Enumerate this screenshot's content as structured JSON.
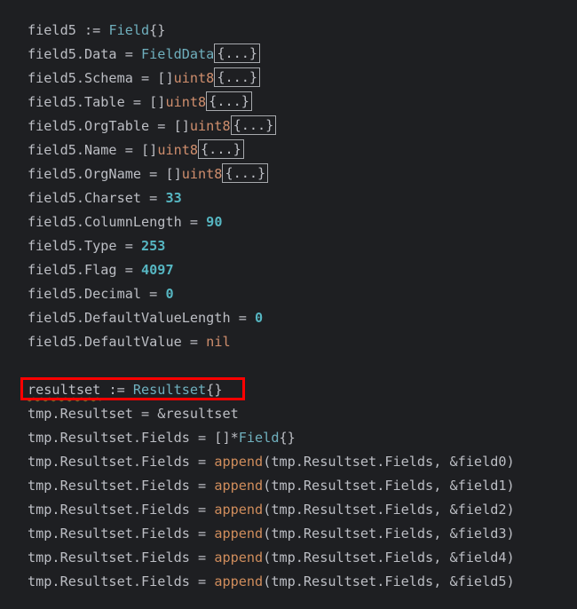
{
  "colors": {
    "background": "#1e1f22",
    "text": "#bcbec4",
    "type": "#6fafbd",
    "keyword": "#cf8e6d",
    "number": "#56b6c2",
    "highlight_box": "#ff0000"
  },
  "code": {
    "l1": {
      "a": "field5 := ",
      "b": "Field",
      "c": "{}"
    },
    "l2": {
      "a": "field5.Data = ",
      "b": "FieldData",
      "fold": "{...}"
    },
    "l3": {
      "a": "field5.Schema = []",
      "b": "uint8",
      "fold": "{...}"
    },
    "l4": {
      "a": "field5.Table = []",
      "b": "uint8",
      "fold": "{...}"
    },
    "l5": {
      "a": "field5.OrgTable = []",
      "b": "uint8",
      "fold": "{...}"
    },
    "l6": {
      "a": "field5.Name = []",
      "b": "uint8",
      "fold": "{...}"
    },
    "l7": {
      "a": "field5.OrgName = []",
      "b": "uint8",
      "fold": "{...}"
    },
    "l8": {
      "a": "field5.Charset = ",
      "n": "33"
    },
    "l9": {
      "a": "field5.ColumnLength = ",
      "n": "90"
    },
    "l10": {
      "a": "field5.Type = ",
      "n": "253"
    },
    "l11": {
      "a": "field5.Flag = ",
      "n": "4097"
    },
    "l12": {
      "a": "field5.Decimal = ",
      "n": "0"
    },
    "l13": {
      "a": "field5.DefaultValueLength = ",
      "n": "0"
    },
    "l14": {
      "a": "field5.DefaultValue = ",
      "k": "nil"
    },
    "l16": {
      "a": "resultset",
      "b": " := ",
      "c": "Resultset",
      "d": "{}"
    },
    "l17": {
      "a": "tmp.Resultset = &resultset"
    },
    "l18": {
      "a": "tmp.Resultset.Fields = []*",
      "b": "Field",
      "c": "{}"
    },
    "l19": {
      "a": "tmp.Resultset.Fields = ",
      "f": "append",
      "c": "(tmp.Resultset.Fields, &field0)"
    },
    "l20": {
      "a": "tmp.Resultset.Fields = ",
      "f": "append",
      "c": "(tmp.Resultset.Fields, &field1)"
    },
    "l21": {
      "a": "tmp.Resultset.Fields = ",
      "f": "append",
      "c": "(tmp.Resultset.Fields, &field2)"
    },
    "l22": {
      "a": "tmp.Resultset.Fields = ",
      "f": "append",
      "c": "(tmp.Resultset.Fields, &field3)"
    },
    "l23": {
      "a": "tmp.Resultset.Fields = ",
      "f": "append",
      "c": "(tmp.Resultset.Fields, &field4)"
    },
    "l24": {
      "a": "tmp.Resultset.Fields = ",
      "f": "append",
      "c": "(tmp.Resultset.Fields, &field5)"
    }
  }
}
